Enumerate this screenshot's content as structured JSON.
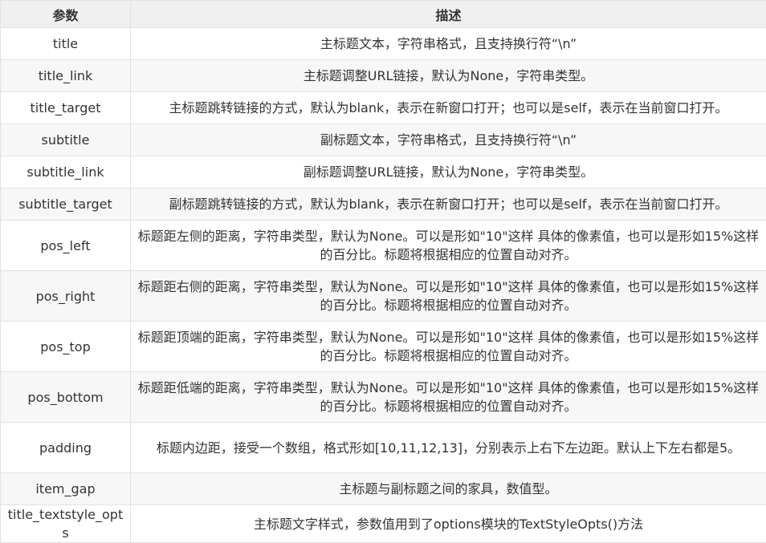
{
  "header": {
    "param": "参数",
    "desc": "描述"
  },
  "rows": [
    {
      "param": "title",
      "desc": "主标题文本，字符串格式，且支持换行符“\\n”"
    },
    {
      "param": "title_link",
      "desc": "主标题调整URL链接，默认为None，字符串类型。"
    },
    {
      "param": "title_target",
      "desc": "主标题跳转链接的方式，默认为blank，表示在新窗口打开；也可以是self，表示在当前窗口打开。"
    },
    {
      "param": "subtitle",
      "desc": "副标题文本，字符串格式，且支持换行符“\\n”"
    },
    {
      "param": "subtitle_link",
      "desc": "副标题调整URL链接，默认为None，字符串类型。"
    },
    {
      "param": "subtitle_target",
      "desc": "副标题跳转链接的方式，默认为blank，表示在新窗口打开；也可以是self，表示在当前窗口打开。"
    },
    {
      "param": "pos_left",
      "desc": "标题距左侧的距离，字符串类型，默认为None。可以是形如\"10\"这样 具体的像素值，也可以是形如15%这样的百分比。标题将根据相应的位置自动对齐。"
    },
    {
      "param": "pos_right",
      "desc": "标题距右侧的距离，字符串类型，默认为None。可以是形如\"10\"这样 具体的像素值，也可以是形如15%这样的百分比。标题将根据相应的位置自动对齐。"
    },
    {
      "param": "pos_top",
      "desc": "标题距顶端的距离，字符串类型，默认为None。可以是形如\"10\"这样 具体的像素值，也可以是形如15%这样的百分比。标题将根据相应的位置自动对齐。"
    },
    {
      "param": "pos_bottom",
      "desc": "标题距低端的距离，字符串类型，默认为None。可以是形如\"10\"这样 具体的像素值，也可以是形如15%这样的百分比。标题将根据相应的位置自动对齐。"
    },
    {
      "param": "padding",
      "desc": "标题内边距，接受一个数组，格式形如[10,11,12,13]，分别表示上右下左边距。默认上下左右都是5。"
    },
    {
      "param": "item_gap",
      "desc": "主标题与副标题之间的家具，数值型。"
    },
    {
      "param": "title_textstyle_opts",
      "desc": "主标题文字样式，参数值用到了options模块的TextStyleOpts()方法"
    }
  ]
}
